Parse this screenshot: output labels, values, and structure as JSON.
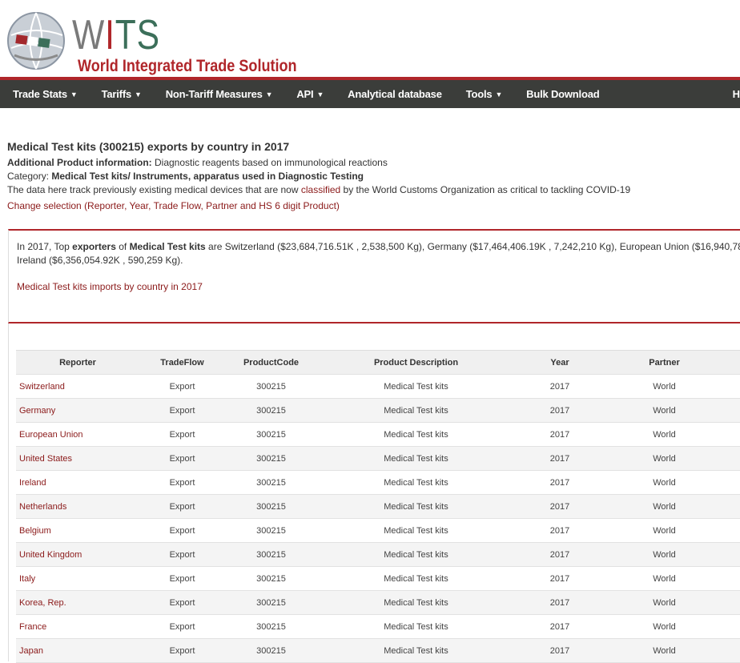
{
  "brand": {
    "wits_w": "W",
    "wits_i": "I",
    "wits_t": "T",
    "wits_s": "S",
    "subtitle": "World Integrated Trade Solution"
  },
  "nav": {
    "items": [
      {
        "label": "Trade Stats",
        "caret": true
      },
      {
        "label": "Tariffs",
        "caret": true
      },
      {
        "label": "Non-Tariff Measures",
        "caret": true
      },
      {
        "label": "API",
        "caret": true
      },
      {
        "label": "Analytical database",
        "caret": false
      },
      {
        "label": "Tools",
        "caret": true
      },
      {
        "label": "Bulk Download",
        "caret": false
      }
    ],
    "last": "H"
  },
  "info": {
    "title": "Medical Test kits (300215) exports by country in 2017",
    "additional_label": "Additional Product information:",
    "additional_value": " Diagnostic reagents based on immunological reactions",
    "category_label": "Category: ",
    "category_value": "Medical Test kits/ Instruments, apparatus used in Diagnostic Testing",
    "track_pre": "The data here track previously existing medical devices that are now ",
    "track_link": "classified",
    "track_post": " by the World Customs Organization as critical to tackling COVID-19",
    "change_link": "Change selection (Reporter, Year, Trade Flow, Partner and HS 6 digit Product)"
  },
  "summary": {
    "p1": "In 2017, Top ",
    "p1_b1": "exporters",
    "p1_mid": " of ",
    "p1_b2": "Medical Test kits",
    "p1_rest": " are Switzerland ($23,684,716.51K , 2,538,500 Kg), Germany ($17,464,406.19K , 7,242,210 Kg), European Union ($16,940,78",
    "p2": "Ireland ($6,356,054.92K , 590,259 Kg).",
    "imports_link": "Medical Test kits imports by country in 2017"
  },
  "table": {
    "headers": [
      "Reporter",
      "TradeFlow",
      "ProductCode",
      "Product Description",
      "Year",
      "Partner"
    ],
    "rows": [
      [
        "Switzerland",
        "Export",
        "300215",
        "Medical Test kits",
        "2017",
        "World"
      ],
      [
        "Germany",
        "Export",
        "300215",
        "Medical Test kits",
        "2017",
        "World"
      ],
      [
        "European Union",
        "Export",
        "300215",
        "Medical Test kits",
        "2017",
        "World"
      ],
      [
        "United States",
        "Export",
        "300215",
        "Medical Test kits",
        "2017",
        "World"
      ],
      [
        "Ireland",
        "Export",
        "300215",
        "Medical Test kits",
        "2017",
        "World"
      ],
      [
        "Netherlands",
        "Export",
        "300215",
        "Medical Test kits",
        "2017",
        "World"
      ],
      [
        "Belgium",
        "Export",
        "300215",
        "Medical Test kits",
        "2017",
        "World"
      ],
      [
        "United Kingdom",
        "Export",
        "300215",
        "Medical Test kits",
        "2017",
        "World"
      ],
      [
        "Italy",
        "Export",
        "300215",
        "Medical Test kits",
        "2017",
        "World"
      ],
      [
        "Korea, Rep.",
        "Export",
        "300215",
        "Medical Test kits",
        "2017",
        "World"
      ],
      [
        "France",
        "Export",
        "300215",
        "Medical Test kits",
        "2017",
        "World"
      ],
      [
        "Japan",
        "Export",
        "300215",
        "Medical Test kits",
        "2017",
        "World"
      ]
    ]
  }
}
